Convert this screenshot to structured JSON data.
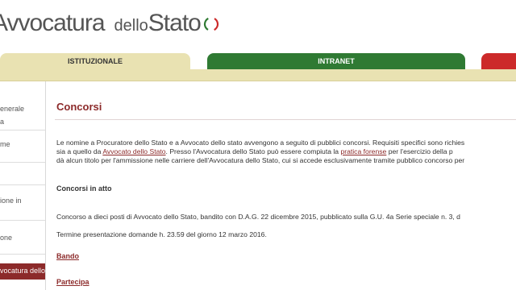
{
  "logo": {
    "part1": "Avvocatura",
    "part2": "dello",
    "part3": "Stato"
  },
  "tabs": {
    "istituzionale": "ISTITUZIONALE",
    "intranet": "INTRANET"
  },
  "sidebar": {
    "items": [
      "enerale",
      "a",
      "me",
      "ione in",
      "one"
    ],
    "active": "vocatura dello"
  },
  "content": {
    "title": "Concorsi",
    "intro": {
      "line1": "Le nomine a Procuratore dello Stato e a Avvocato dello stato avvengono a seguito di pubblici concorsi. Requisiti specifici sono richies",
      "line2_before": "sia a quello da ",
      "line2_link": "Avvocato dello Stato",
      "line2_middle": ". Presso l'Avvocatura dello Stato può essere compiuta la ",
      "line2_link2": "pratica forense",
      "line2_after": " per l'esercizio della p",
      "line3": "dà alcun titolo per l'ammissione nelle carriere dell'Avvocatura dello Stato, cui si accede esclusivamente tramite pubblico concorso per"
    },
    "section_heading": "Concorsi in atto",
    "announcement": "Concorso a dieci posti di Avvocato dello Stato, bandito con D.A.G. 22 dicembre 2015, pubblicato sulla G.U. 4a Serie speciale n. 3, d",
    "deadline": "Termine presentazione domande h. 23.59 del giorno 12 marzo 2016.",
    "links": {
      "bando": "Bando",
      "partecipa": "Partecipa"
    }
  }
}
